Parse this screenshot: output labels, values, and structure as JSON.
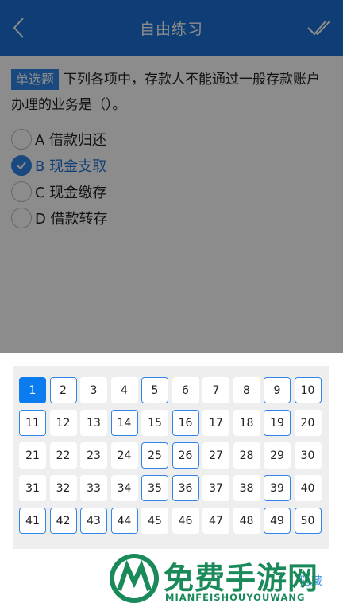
{
  "header": {
    "title": "自由练习",
    "back_icon": "chevron-left-icon",
    "submit_icon": "double-check-icon"
  },
  "question": {
    "type_label": "单选题",
    "text": "下列各项中，存款人不能通过一般存款账户办理的业务是（）。",
    "options": [
      {
        "label": "A 借款归还",
        "selected": false
      },
      {
        "label": "B 现金支取",
        "selected": true
      },
      {
        "label": "C 现金缴存",
        "selected": false
      },
      {
        "label": "D 借款转存",
        "selected": false
      }
    ]
  },
  "answer_sheet": {
    "current": 1,
    "answered": [
      2,
      5,
      9,
      10,
      11,
      14,
      16,
      19,
      25,
      26,
      35,
      36,
      39,
      41,
      42,
      43,
      44,
      49,
      50
    ],
    "numbers": [
      "1",
      "2",
      "3",
      "4",
      "5",
      "6",
      "7",
      "8",
      "9",
      "10",
      "11",
      "12",
      "13",
      "14",
      "15",
      "16",
      "17",
      "18",
      "19",
      "20",
      "21",
      "22",
      "23",
      "24",
      "25",
      "26",
      "27",
      "28",
      "29",
      "30",
      "31",
      "32",
      "33",
      "34",
      "35",
      "36",
      "37",
      "38",
      "39",
      "40",
      "41",
      "42",
      "43",
      "44",
      "45",
      "46",
      "47",
      "48",
      "49",
      "50"
    ],
    "hide_label": "隐藏"
  },
  "watermark": {
    "title": "免费手游网",
    "subtitle": "MIANFEISHOUYOUWANG"
  },
  "colors": {
    "primary": "#1b71d6",
    "accent": "#2f86e8",
    "watermark": "#1a8a5a"
  }
}
